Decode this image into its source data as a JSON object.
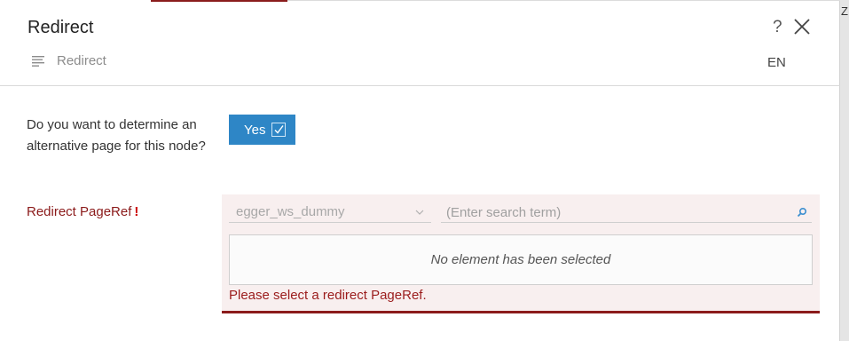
{
  "backdrop": {
    "edge_letter": "Z"
  },
  "dialog": {
    "title": "Redirect",
    "help_label": "?",
    "breadcrumb": "Redirect",
    "language": "EN"
  },
  "form": {
    "question": "Do you want to determine an alternative page for this node?",
    "toggle_label": "Yes",
    "toggle_state": true,
    "pageref_label": "Redirect PageRef",
    "required_mark": "!",
    "project_value": "egger_ws_dummy",
    "search_placeholder": "(Enter search term)",
    "empty_selection": "No element has been selected",
    "error_message": "Please select a redirect PageRef."
  },
  "colors": {
    "accent_blue": "#2e86c6",
    "error_red": "#8b1a1a",
    "error_bg": "#f8efef"
  },
  "icons": {
    "breadcrumb": "list-lines-icon",
    "close": "close-icon",
    "toggle": "checkbox-checked-icon",
    "dropdown": "chevron-down-icon",
    "search": "search-icon"
  }
}
